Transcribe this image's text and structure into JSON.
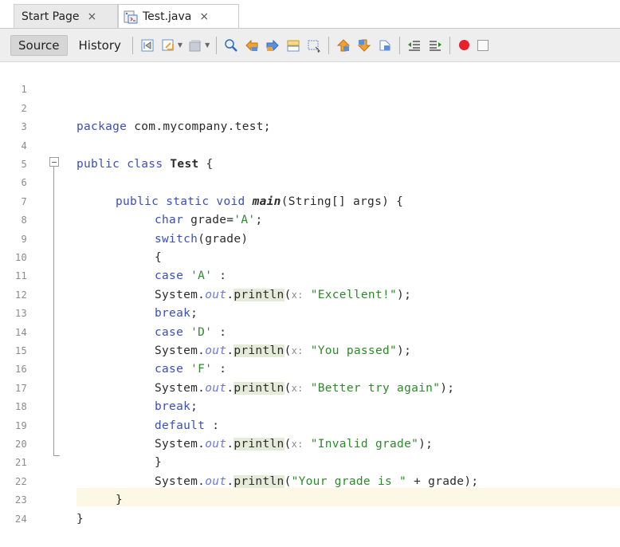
{
  "tabs": {
    "start_page": "Start Page",
    "active_file": "Test.java",
    "close_glyph": "×"
  },
  "toolbar": {
    "source_label": "Source",
    "history_label": "History",
    "icons": [
      "last-edit-icon",
      "back-icon",
      "forward-icon",
      "find-selection-icon",
      "find-previous-icon",
      "find-next-icon",
      "toggle-highlight-icon",
      "toggle-rect-selection-icon",
      "previous-bookmark-icon",
      "next-bookmark-icon",
      "toggle-bookmark-icon",
      "shift-left-icon",
      "shift-right-icon",
      "start-macro-icon",
      "stop-macro-icon"
    ]
  },
  "editor": {
    "line_numbers": [
      "1",
      "2",
      "3",
      "4",
      "5",
      "6",
      "7",
      "8",
      "9",
      "10",
      "11",
      "12",
      "13",
      "14",
      "15",
      "16",
      "17",
      "18",
      "19",
      "20",
      "21",
      "22",
      "23",
      "24"
    ],
    "lines": {
      "l2": {
        "kw": "package",
        "rest": " com.mycompany.test;"
      },
      "l4": {
        "kw": "public class",
        "name": "Test",
        "rest": " {"
      },
      "l6": {
        "kw": "public static void",
        "method": "main",
        "rest": "(String[] args) {"
      },
      "l7": {
        "kw": "char",
        "mid": " grade=",
        "str": "'A'",
        "end": ";"
      },
      "l8": {
        "kw": "switch",
        "rest": "(grade)"
      },
      "l9": {
        "text": "{"
      },
      "l10": {
        "kw": "case",
        "str": "'A'",
        "end": " :"
      },
      "l11": {
        "pre": "System.",
        "field": "out",
        "dot": ".",
        "call": "println",
        "open": "(",
        "hint": "x:",
        "str": "\"Excellent!\"",
        "close": ");"
      },
      "l12": {
        "kw": "break",
        "end": ";"
      },
      "l13": {
        "kw": "case",
        "str": "'D'",
        "end": " :"
      },
      "l14": {
        "pre": "System.",
        "field": "out",
        "dot": ".",
        "call": "println",
        "open": "(",
        "hint": "x:",
        "str": "\"You passed\"",
        "close": ");"
      },
      "l15": {
        "kw": "case",
        "str": "'F'",
        "end": " :"
      },
      "l16": {
        "pre": "System.",
        "field": "out",
        "dot": ".",
        "call": "println",
        "open": "(",
        "hint": "x:",
        "str": "\"Better try again\"",
        "close": ");"
      },
      "l17": {
        "kw": "break",
        "end": ";"
      },
      "l18": {
        "kw": "default",
        "end": " :"
      },
      "l19": {
        "pre": "System.",
        "field": "out",
        "dot": ".",
        "call": "println",
        "open": "(",
        "hint": "x:",
        "str": "\"Invalid grade\"",
        "close": ");"
      },
      "l20": {
        "text": "}"
      },
      "l21": {
        "pre": "System.",
        "field": "out",
        "dot": ".",
        "call": "println",
        "open": "(",
        "str": "\"Your grade is \"",
        "close": " + grade);"
      },
      "l22": {
        "text": "}"
      },
      "l23": {
        "text": "}"
      }
    }
  },
  "colors": {
    "keyword": "#3a4fbd",
    "string": "#2d8a2a",
    "method_highlight": "#e4ecd9",
    "current_line": "#fcf8e5",
    "record_button": "#e8212b"
  }
}
